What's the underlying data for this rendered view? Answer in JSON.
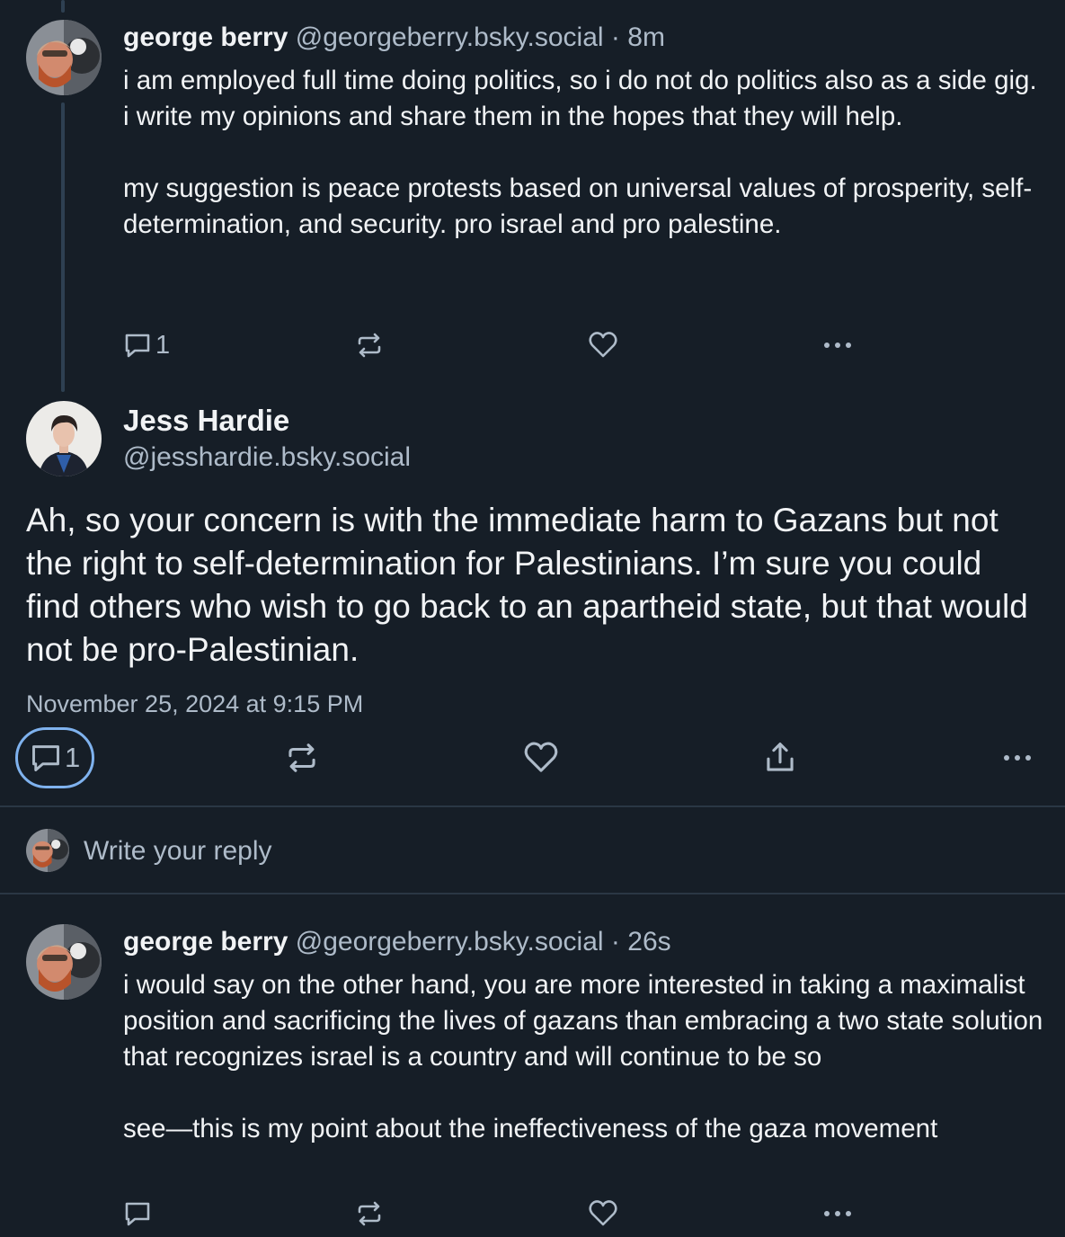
{
  "posts": [
    {
      "author_name": "george berry",
      "handle": "@georgeberry.bsky.social",
      "separator": "·",
      "time": "8m",
      "body": "i am employed full time doing politics, so i do not do politics also as a side gig. i write my opinions and share them in the hopes that they will help.\n\nmy suggestion is peace protests based on universal values of prosperity, self-determination, and security. pro israel and pro palestine.",
      "reply_count": "1"
    },
    {
      "author_name": "george berry",
      "handle": "@georgeberry.bsky.social",
      "separator": "·",
      "time": "26s",
      "body": "i would say on the other hand, you are more interested in taking a maximalist position and sacrificing the lives of gazans than embracing a two state solution that recognizes israel is a country and will continue to be so\n\nsee—this is my point about the ineffectiveness of the gaza movement",
      "reply_count": ""
    }
  ],
  "main_post": {
    "author_name": "Jess Hardie",
    "handle": "@jesshardie.bsky.social",
    "body": "Ah, so your concern is with the immediate harm to Gazans but not the right to self-determination for Palestinians. I’m sure you could find others who wish to go back to an apartheid state, but that would not be pro-Palestinian.",
    "date": "November 25, 2024 at 9:15 PM",
    "reply_count": "1"
  },
  "compose": {
    "placeholder": "Write your reply"
  },
  "colors": {
    "background": "#161e27",
    "text": "#f1f3f5",
    "muted": "#aebbc9",
    "accent_outline": "#7fb2ee",
    "thread_line": "#2e4052"
  }
}
